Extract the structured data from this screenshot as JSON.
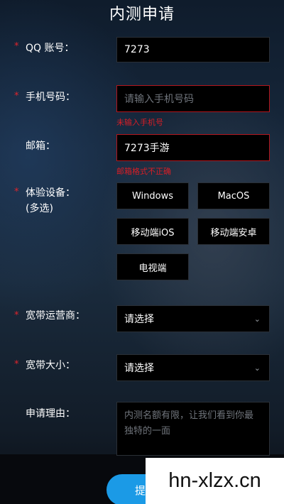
{
  "form": {
    "title": "内测申请",
    "required_mark": "*",
    "qq": {
      "label": "QQ 账号：",
      "value": "7273"
    },
    "phone": {
      "label": "手机号码：",
      "placeholder": "请输入手机号码",
      "error": "未输入手机号"
    },
    "email": {
      "label": "邮箱：",
      "value": "7273手游",
      "error": "邮箱格式不正确"
    },
    "devices": {
      "label": "体验设备：",
      "sublabel": "(多选)",
      "options": [
        "Windows",
        "MacOS",
        "移动端iOS",
        "移动端安卓",
        "电视端"
      ]
    },
    "isp": {
      "label": "宽带运营商：",
      "value": "请选择"
    },
    "bandwidth": {
      "label": "宽带大小：",
      "value": "请选择"
    },
    "reason": {
      "label": "申请理由：",
      "placeholder": "内测名额有限，让我们看到你最独特的一面"
    },
    "submit_label": "提交"
  },
  "watermark": {
    "text": "hn-xlzx.cn"
  },
  "icons": {
    "chevron": "chevron-down-icon"
  }
}
